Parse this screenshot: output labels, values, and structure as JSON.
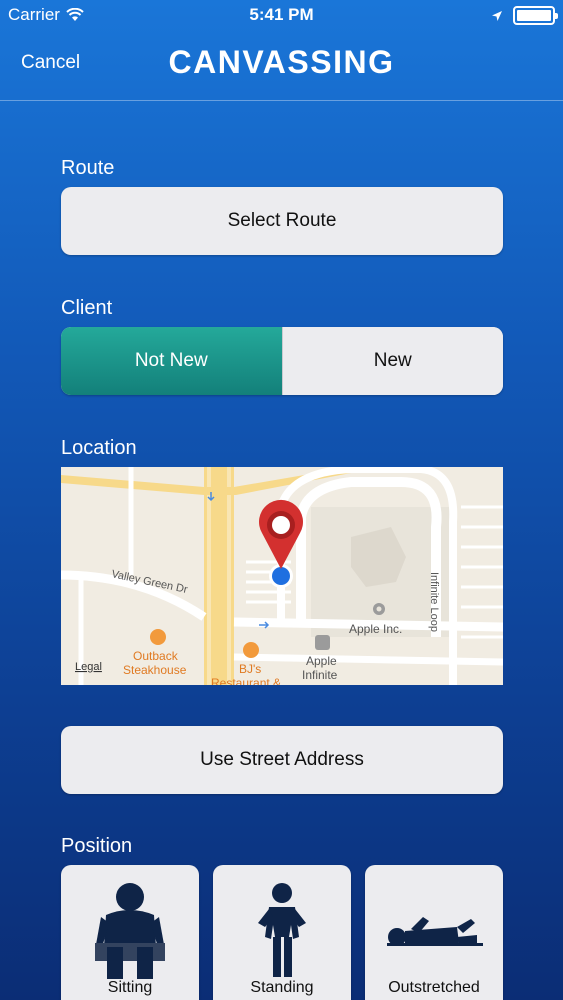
{
  "status_bar": {
    "carrier": "Carrier",
    "time": "5:41 PM"
  },
  "nav": {
    "cancel_label": "Cancel",
    "title": "CANVASSING"
  },
  "route": {
    "label": "Route",
    "button_label": "Select Route"
  },
  "client": {
    "label": "Client",
    "options": [
      "Not New",
      "New"
    ],
    "selected": "Not New"
  },
  "location": {
    "label": "Location",
    "map": {
      "street_label": "Valley Green Dr",
      "road_label": "Infinite Loop",
      "poi": [
        {
          "name_line1": "Apple Inc.",
          "name_line2": ""
        },
        {
          "name_line1": "Outback",
          "name_line2": "Steakhouse"
        },
        {
          "name_line1": "BJ's",
          "name_line2": "Restaurant &"
        },
        {
          "name_line1": "Apple",
          "name_line2": "Infinite"
        }
      ],
      "legal_label": "Legal"
    },
    "street_address_button": "Use Street Address"
  },
  "position": {
    "label": "Position",
    "options": [
      "Sitting",
      "Standing",
      "Outstretched"
    ]
  },
  "colors": {
    "segment_selected": "#1a9a8e",
    "map_pin": "#d3302f",
    "user_dot": "#1f6fe0",
    "figure": "#0f2447"
  }
}
